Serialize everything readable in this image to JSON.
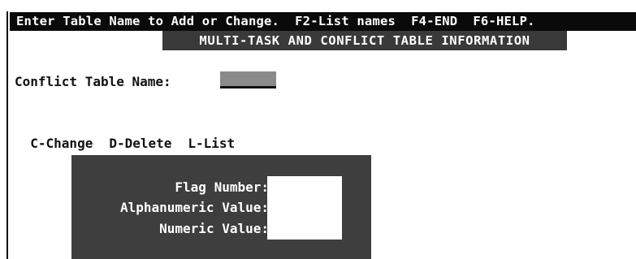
{
  "top_bar": {
    "text": "Enter Table Name to Add or Change.  F2-List names  F4-END  F6-HELP."
  },
  "title_bar": {
    "text": "MULTI-TASK AND CONFLICT TABLE INFORMATION"
  },
  "conflict_table": {
    "label": "Conflict Table Name:",
    "value": ""
  },
  "commands": [
    {
      "label": "C-Change"
    },
    {
      "label": "D-Delete"
    },
    {
      "label": "L-List"
    }
  ],
  "panel": {
    "flag_number_label": "Flag Number:",
    "alphanumeric_value_label": "Alphanumeric Value:",
    "numeric_value_label": "Numeric Value:"
  }
}
